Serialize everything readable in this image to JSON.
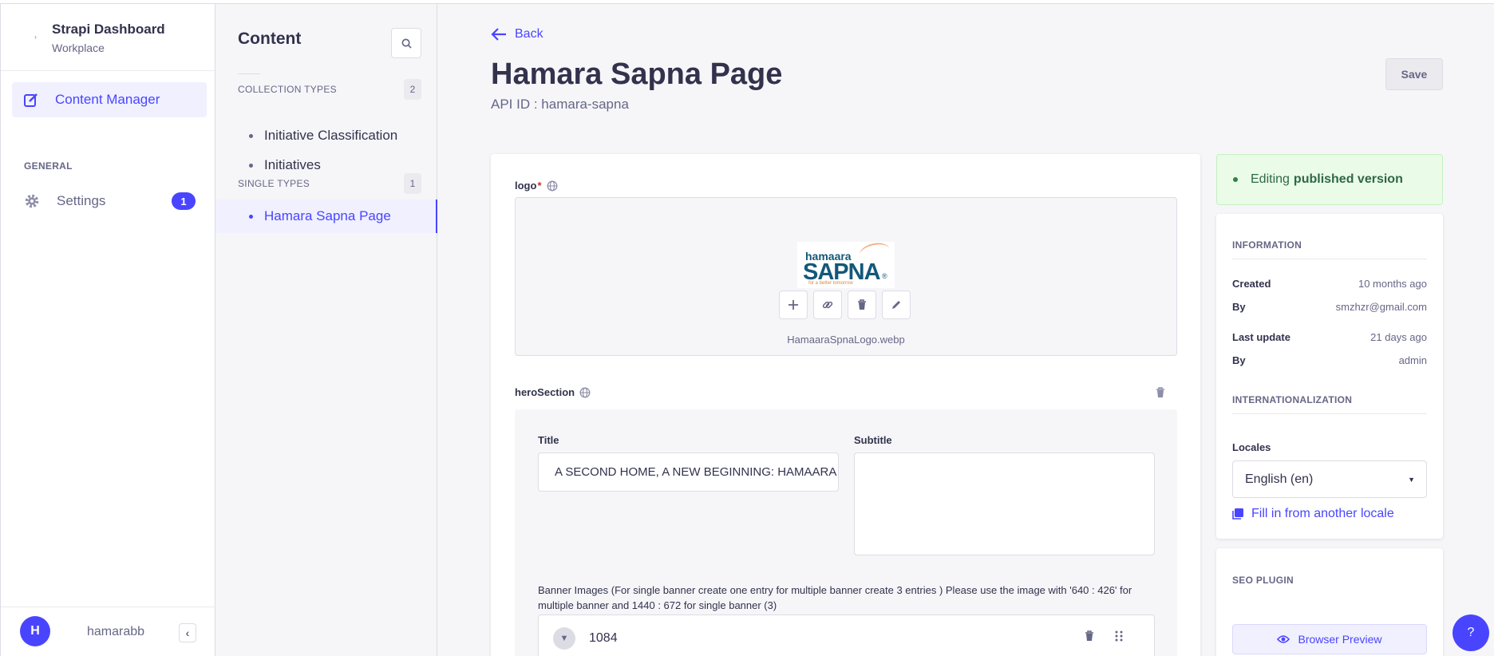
{
  "app": {
    "name": "Strapi Dashboard",
    "workspace": "Workplace"
  },
  "leftnav": {
    "content_manager": "Content Manager",
    "general_heading": "GENERAL",
    "settings": "Settings",
    "settings_badge": "1",
    "user_initial": "H",
    "username": "hamarabb"
  },
  "subnav": {
    "title": "Content",
    "collection_heading": "COLLECTION TYPES",
    "collection_count": "2",
    "collection_items": [
      "Initiative Classification",
      "Initiatives"
    ],
    "single_heading": "SINGLE TYPES",
    "single_count": "1",
    "single_items": [
      "Hamara Sapna Page"
    ]
  },
  "header": {
    "back": "Back",
    "title": "Hamara Sapna Page",
    "api_id": "API ID : hamara-sapna",
    "save": "Save"
  },
  "form": {
    "logo_label": "logo",
    "logo_required": "*",
    "logo_image": {
      "line1": "hamaara",
      "line2": "SAPNA",
      "reg": "®",
      "tagline": "for a better tomorrow"
    },
    "logo_filename": "HamaaraSpnaLogo.webp",
    "hero_label": "heroSection",
    "title_label": "Title",
    "title_value": "A SECOND HOME, A NEW BEGINNING: HAMAARA SAPNA",
    "subtitle_label": "Subtitle",
    "subtitle_value": "",
    "banner_label": "Banner Images (For single banner create one entry for multiple banner create 3 entries ) Please use the image with '640 : 426' for multiple banner and 1440 : 672 for single banner (3)",
    "banner_entry": "1084"
  },
  "sidebar": {
    "status_prefix": "Editing",
    "status_bold": "published version",
    "info_heading": "INFORMATION",
    "created_label": "Created",
    "created_value": "10 months ago",
    "created_by_label": "By",
    "created_by_value": "smzhzr@gmail.com",
    "updated_label": "Last update",
    "updated_value": "21 days ago",
    "updated_by_label": "By",
    "updated_by_value": "admin",
    "i18n_heading": "INTERNATIONALIZATION",
    "locales_label": "Locales",
    "locale_selected": "English (en)",
    "fill_locale": "Fill in from another locale",
    "seo_heading": "SEO PLUGIN",
    "browser_preview": "Browser Preview"
  },
  "help_label": "?",
  "colors": {
    "primary": "#4945ff",
    "success_bg": "#eafbe7",
    "success_text": "#2f6846",
    "danger": "#d02b20"
  }
}
